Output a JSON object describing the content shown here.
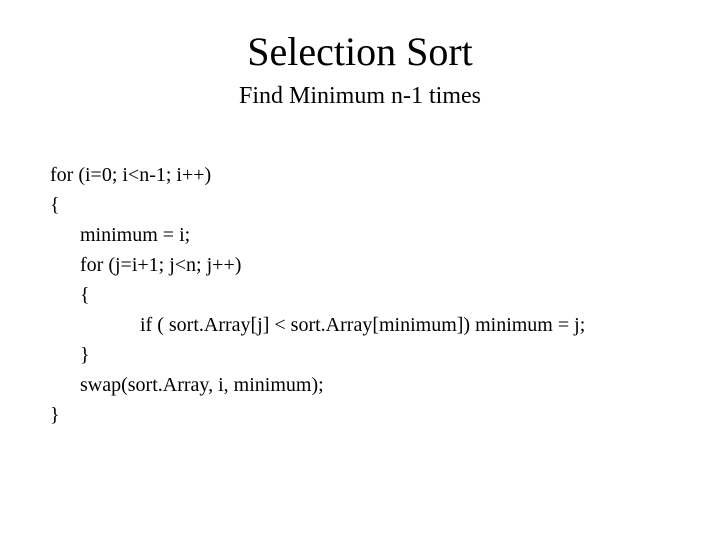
{
  "title": "Selection Sort",
  "subtitle": "Find Minimum n-1 times",
  "code": {
    "line1": "for (i=0; i<n-1; i++)",
    "line2": "{",
    "line3": "minimum = i;",
    "line4": "for (j=i+1; j<n; j++)",
    "line5": "{",
    "line6": "if ( sort.Array[j] < sort.Array[minimum])  minimum = j;",
    "line7": "}",
    "line8": "swap(sort.Array, i, minimum);",
    "line9": "}"
  }
}
